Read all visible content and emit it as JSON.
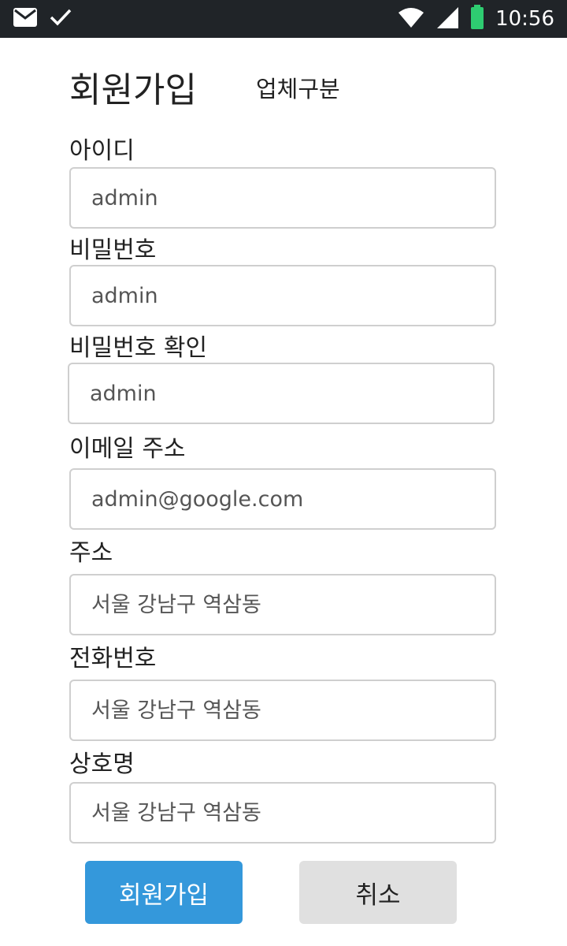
{
  "status_bar": {
    "time": "10:56",
    "icons": [
      "mail-icon",
      "check-icon",
      "wifi-icon",
      "signal-icon",
      "battery-icon"
    ],
    "battery_color": "#2ecc71"
  },
  "header": {
    "title": "회원가입",
    "subtitle": "업체구분"
  },
  "form": {
    "fields": [
      {
        "label": "아이디",
        "value": "admin"
      },
      {
        "label": "비밀번호",
        "value": "admin"
      },
      {
        "label": "비밀번호 확인",
        "value": "admin"
      },
      {
        "label": "이메일 주소",
        "value": "admin@google.com"
      },
      {
        "label": "주소",
        "placeholder": "서울 강남구 역삼동"
      },
      {
        "label": "전화번호",
        "placeholder": "서울 강남구 역삼동"
      },
      {
        "label": "상호명",
        "placeholder": "서울 강남구 역삼동"
      }
    ],
    "submit_label": "회원가입",
    "cancel_label": "취소"
  },
  "colors": {
    "primary": "#3498db",
    "secondary": "#e0e0e0",
    "status_bar": "#202428"
  }
}
